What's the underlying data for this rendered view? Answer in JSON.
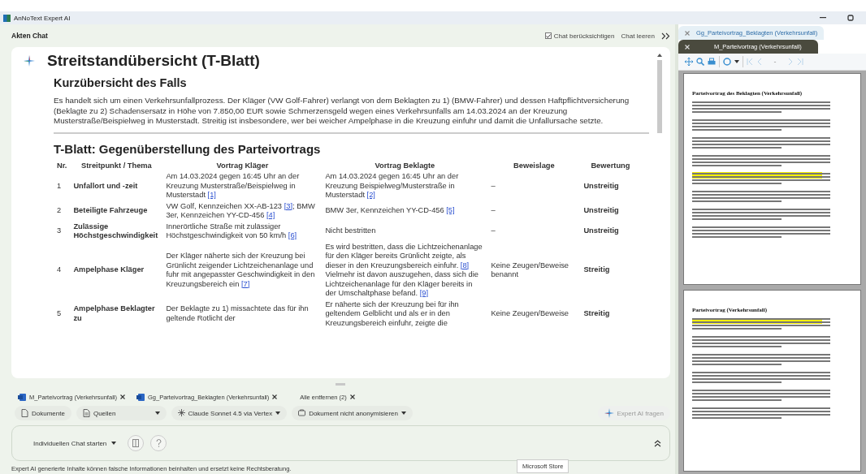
{
  "window": {
    "title": "AnNoText Expert AI"
  },
  "chat_header": {
    "title": "Akten Chat",
    "consider_chat": {
      "label": "Chat berücksichtigen",
      "checked": true
    },
    "clear_label": "Chat leeren"
  },
  "answer": {
    "title": "Streitstandübersicht (T-Blatt)",
    "summary_heading": "Kurzübersicht des Falls",
    "summary": "Es handelt sich um einen Verkehrsunfallprozess. Der Kläger (VW Golf-Fahrer) verlangt von dem Beklagten zu 1) (BMW-Fahrer) und dessen Haftpflichtversicherung (Beklagte zu 2) Schadensersatz in Höhe von 7.850,00 EUR sowie Schmerzensgeld wegen eines Verkehrsunfalls am 14.03.2024 an der Kreuzung Musterstraße/Beispielweg in Musterstadt. Streitig ist insbesondere, wer bei weicher Ampelphase in die Kreuzung einfuhr und damit die Unfallursache setzte.",
    "table_heading": "T-Blatt: Gegenüberstellung des Parteivortrags",
    "table": {
      "columns": [
        "Nr.",
        "Streitpunkt / Thema",
        "Vortrag Kläger",
        "Vortrag Beklagte",
        "Beweislage",
        "Bewertung"
      ],
      "rows": [
        {
          "nr": "1",
          "topic": "Unfallort und -zeit",
          "plaintiff": [
            {
              "kind": "text",
              "text": "Am 14.03.2024 gegen 16:45 Uhr an der Kreuzung Musterstraße/Beispielweg in Musterstadt "
            },
            {
              "kind": "ref",
              "text": "[1]"
            }
          ],
          "defendant": [
            {
              "kind": "text",
              "text": "Am 14.03.2024 gegen 16:45 Uhr an der Kreuzung Beispielweg/Musterstraße in Musterstadt "
            },
            {
              "kind": "ref",
              "text": "[2]"
            }
          ],
          "evidence": "–",
          "rating": "Unstreitig"
        },
        {
          "nr": "2",
          "topic": "Beteiligte Fahrzeuge",
          "plaintiff": [
            {
              "kind": "text",
              "text": "VW Golf, Kennzeichen XX-AB-123 "
            },
            {
              "kind": "ref",
              "text": "[3]"
            },
            {
              "kind": "text",
              "text": "; BMW 3er, Kennzeichen YY-CD-456 "
            },
            {
              "kind": "ref",
              "text": "[4]"
            }
          ],
          "defendant": [
            {
              "kind": "text",
              "text": "BMW 3er, Kennzeichen YY-CD-456 "
            },
            {
              "kind": "ref",
              "text": "[5]"
            }
          ],
          "evidence": "–",
          "rating": "Unstreitig"
        },
        {
          "nr": "3",
          "topic": "Zulässige Höchstgeschwindigkeit",
          "plaintiff": [
            {
              "kind": "text",
              "text": "Innerörtliche Straße mit zulässiger Höchstgeschwindigkeit von 50 km/h "
            },
            {
              "kind": "ref",
              "text": "[6]"
            }
          ],
          "defendant": [
            {
              "kind": "text",
              "text": "Nicht bestritten"
            }
          ],
          "evidence": "–",
          "rating": "Unstreitig"
        },
        {
          "nr": "4",
          "topic": "Ampelphase Kläger",
          "plaintiff": [
            {
              "kind": "text",
              "text": "Der Kläger näherte sich der Kreuzung bei Grünlicht zeigender Lichtzeichenanlage und fuhr mit angepasster Geschwindigkeit in den Kreuzungsbereich ein "
            },
            {
              "kind": "ref",
              "text": "[7]"
            }
          ],
          "defendant": [
            {
              "kind": "text",
              "text": "Es wird bestritten, dass die Lichtzeichenanlage für den Kläger bereits Grünlicht zeigte, als dieser in den Kreuzungsbereich einfuhr. "
            },
            {
              "kind": "ref",
              "text": "[8]"
            },
            {
              "kind": "text",
              "text": " Vielmehr ist davon auszugehen, dass sich die Lichtzeichenanlage für den Kläger bereits in der Umschaltphase befand. "
            },
            {
              "kind": "ref",
              "text": "[9]"
            }
          ],
          "evidence": "Keine Zeugen/Beweise benannt",
          "rating": "Streitig"
        },
        {
          "nr": "5",
          "topic": "Ampelphase Beklagter zu",
          "plaintiff": [
            {
              "kind": "text",
              "text": "Der Beklagte zu 1) missachtete das für ihn geltende Rotlicht der"
            }
          ],
          "defendant": [
            {
              "kind": "text",
              "text": "Er näherte sich der Kreuzung bei für ihn geltendem Gelblicht und als er in den Kreuzungsbereich einfuhr, zeigte die"
            }
          ],
          "evidence": "Keine Zeugen/Beweise",
          "rating": "Streitig"
        }
      ]
    }
  },
  "attachments": [
    {
      "label": "M_Parteivortrag (Verkehrsunfall)",
      "kind": "word"
    },
    {
      "label": "Gg_Parteivortrag_Beklagten (Verkehrsunfall)",
      "kind": "word"
    },
    {
      "label": "Alle entfernen (2)",
      "kind": "clear"
    }
  ],
  "options": [
    {
      "label": "Dokumente",
      "kind": "documents"
    },
    {
      "label": "Quellen",
      "kind": "sources"
    },
    {
      "label": "Claude Sonnet 4.5 via Vertex",
      "kind": "model"
    },
    {
      "label": "Dokument nicht anonymisieren",
      "kind": "anonymize"
    }
  ],
  "ask_button": {
    "label": "Expert AI fragen",
    "disabled": true
  },
  "chat_bar": {
    "start_label": "Individuellen Chat starten"
  },
  "disclaimer": "Expert AI generierte Inhalte können falsche Informationen beinhalten und ersetzt keine Rechtsberatung.",
  "tooltip": "Microsoft Store",
  "viewer": {
    "tabs": [
      {
        "label": "Gg_Parteivortrag_Beklagten (Verkehrsunfall)",
        "selected": false
      },
      {
        "label": "M_Parteivortrag (Verkehrsunfall)",
        "selected": true
      }
    ],
    "page_field": "-",
    "pages": [
      {
        "title": "Parteivortrag des Beklagten (Verkehrsunfall)",
        "highlight": true
      },
      {
        "title": "Parteivortrag (Verkehrsunfall)",
        "highlight": true
      }
    ]
  }
}
